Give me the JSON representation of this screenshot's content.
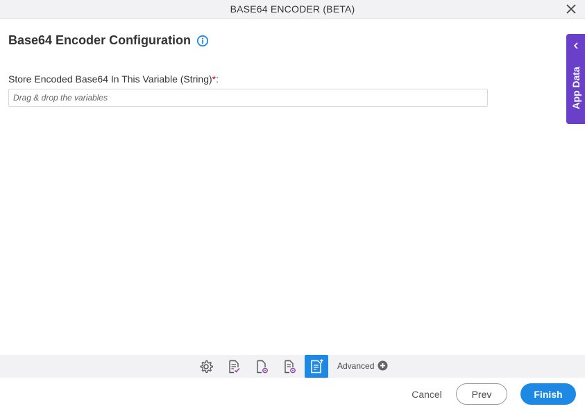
{
  "window": {
    "title": "BASE64 ENCODER (BETA)"
  },
  "heading": {
    "title": "Base64 Encoder Configuration"
  },
  "field": {
    "label": "Store Encoded Base64 In This Variable (String)",
    "required_mark": "*",
    "colon": ":",
    "placeholder": "Drag & drop the variables",
    "value": ""
  },
  "app_data_tab": {
    "label": "App Data"
  },
  "toolbar": {
    "tools": [
      {
        "icon": "gear-icon"
      },
      {
        "icon": "document-check-icon"
      },
      {
        "icon": "document-gear-icon"
      },
      {
        "icon": "document-list-gear-icon"
      },
      {
        "icon": "base64-document-icon",
        "active": true
      }
    ],
    "advanced_label": "Advanced"
  },
  "footer": {
    "cancel_label": "Cancel",
    "prev_label": "Prev",
    "finish_label": "Finish"
  },
  "colors": {
    "accent": "#1e88e5",
    "app_data_tab": "#6a3fc9",
    "required": "#d0021b"
  }
}
